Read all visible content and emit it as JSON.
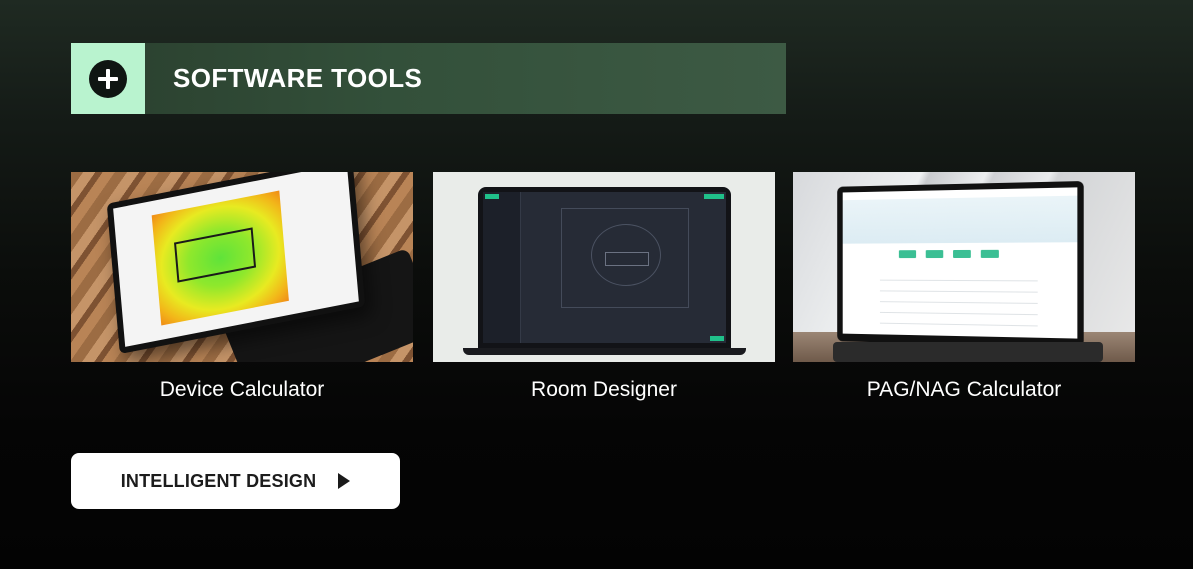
{
  "header": {
    "title": "SOFTWARE TOOLS",
    "icon": "plus-circle-icon",
    "accent_color": "#b9f3cf"
  },
  "tools": [
    {
      "label": "Device Calculator",
      "image": "laptop-heatmap-screenshot"
    },
    {
      "label": "Room Designer",
      "image": "laptop-room-layout-screenshot"
    },
    {
      "label": "PAG/NAG Calculator",
      "image": "laptop-calculator-screenshot"
    }
  ],
  "cta": {
    "label": "INTELLIGENT DESIGN",
    "icon": "play-icon"
  }
}
